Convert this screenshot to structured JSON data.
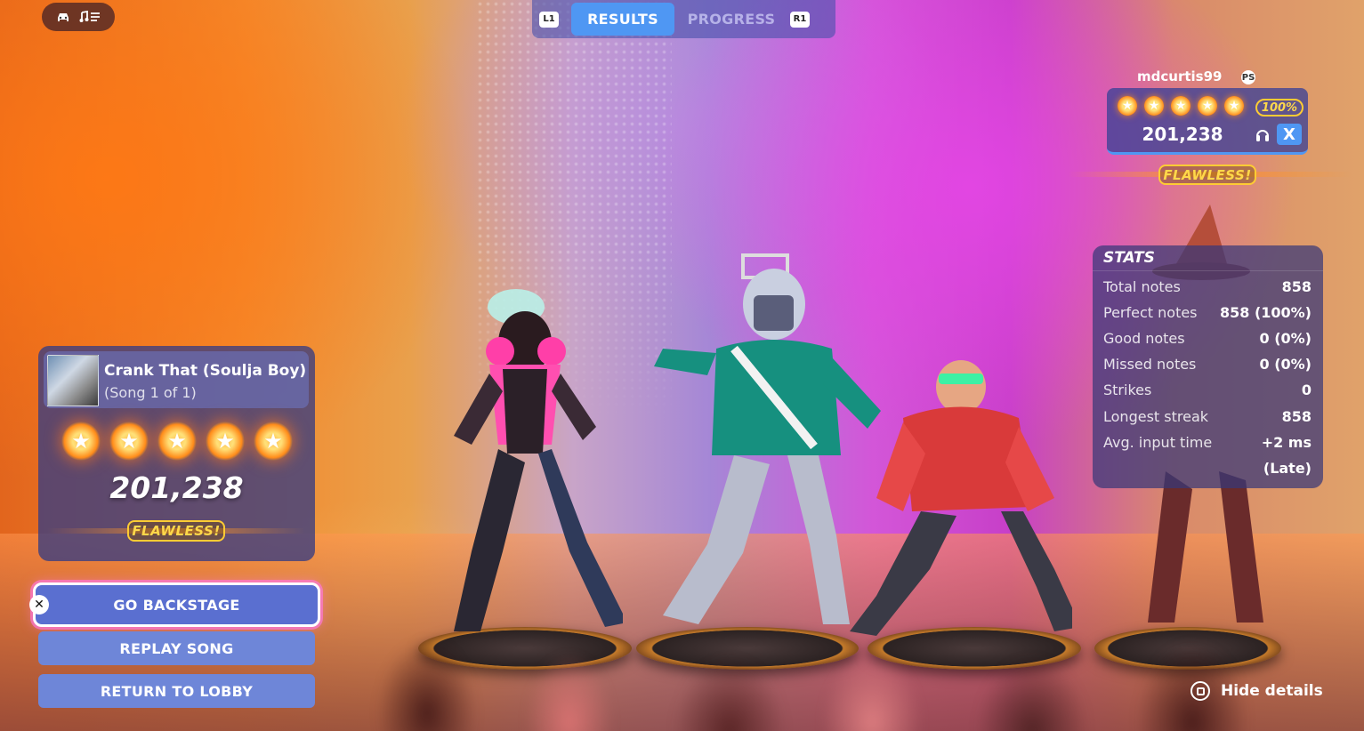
{
  "tabs": {
    "left_bumper": "L1",
    "right_bumper": "R1",
    "items": [
      {
        "label": "RESULTS",
        "active": true
      },
      {
        "label": "PROGRESS",
        "active": false
      }
    ]
  },
  "top_pill": {
    "icons": [
      "car-icon",
      "music-list-icon"
    ]
  },
  "song_card": {
    "title": "Crank That (Soulja Boy)",
    "subtitle": "(Song 1 of 1)",
    "stars": 5,
    "star_glyph": "★",
    "score": "201,238",
    "badge": "FLAWLESS!"
  },
  "menu": {
    "go_backstage": "GO BACKSTAGE",
    "replay_song": "REPLAY SONG",
    "return_to_lobby": "RETURN TO LOBBY",
    "select_hint": "✕"
  },
  "player": {
    "username": "mdcurtis99",
    "platform_icon": "playstation-icon",
    "stars": 5,
    "percent": "100%",
    "score": "201,238",
    "instrument_key": "X",
    "badge": "FLAWLESS!"
  },
  "stats": {
    "title": "STATS",
    "rows": [
      {
        "label": "Total notes",
        "value": "858"
      },
      {
        "label": "Perfect notes",
        "value": "858 (100%)"
      },
      {
        "label": "Good notes",
        "value": "0 (0%)"
      },
      {
        "label": "Missed notes",
        "value": "0 (0%)"
      },
      {
        "label": "Strikes",
        "value": "0"
      },
      {
        "label": "Longest streak",
        "value": "858"
      },
      {
        "label": "Avg. input time",
        "value": "+2 ms"
      },
      {
        "label": "",
        "value": "(Late)"
      }
    ]
  },
  "hide_details": "Hide details",
  "colors": {
    "accent_blue": "#4f97f3",
    "flawless_gold": "#ffd84a",
    "button_blue": "#6e86d8"
  }
}
